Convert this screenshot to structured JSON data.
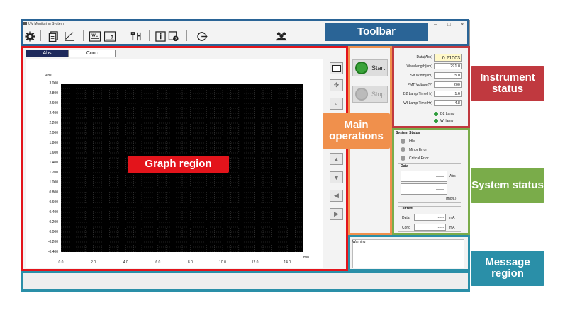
{
  "window": {
    "title": "UV Monitoring System"
  },
  "window_controls": [
    "–",
    "□",
    "×"
  ],
  "tabs": [
    {
      "label": "Abs"
    },
    {
      "label": "Conc"
    }
  ],
  "chart_data": {
    "type": "line",
    "ylabel": "Abs",
    "xlabel": "min",
    "yticks": [
      "3.000",
      "2.800",
      "2.600",
      "2.400",
      "2.200",
      "2.000",
      "1.800",
      "1.600",
      "1.400",
      "1.200",
      "1.000",
      "0.800",
      "0.600",
      "0.400",
      "0.200",
      "0.000",
      "-0.200",
      "-0.400"
    ],
    "xticks": [
      "0.0",
      "2.0",
      "4.0",
      "6.0",
      "8.0",
      "10.0",
      "12.0",
      "14.0"
    ],
    "ylim": [
      -0.4,
      3.0
    ],
    "xlim": [
      0,
      15
    ],
    "grid": true,
    "series": []
  },
  "operations": {
    "start": "Start",
    "stop": "Stop"
  },
  "instrument": {
    "rows": [
      {
        "label": "Data(Abs)",
        "value": "0.21003"
      },
      {
        "label": "Wavelength(nm)",
        "value": "291.0"
      },
      {
        "label": "Slit Width(nm)",
        "value": "5.0"
      },
      {
        "label": "PMT Voltage(V)",
        "value": "200"
      },
      {
        "label": "D2 Lamp Time(Hr)",
        "value": "1.6"
      },
      {
        "label": "WI Lamp Time(Hr)",
        "value": "4.8"
      }
    ],
    "lamps": [
      {
        "label": "D2 Lamp"
      },
      {
        "label": "WI lamp"
      }
    ]
  },
  "system": {
    "title": "System Status",
    "states": [
      {
        "label": "Idle"
      },
      {
        "label": "Minor Error"
      },
      {
        "label": "Critical Error"
      }
    ],
    "data_title": "Data",
    "data_rows": [
      {
        "value": "------",
        "unit": "Abs"
      },
      {
        "value": "------",
        "unit": "(mg/L)"
      }
    ],
    "current_title": "Current",
    "current_rows": [
      {
        "label": "Data",
        "value": "-----",
        "unit": "mA"
      },
      {
        "label": "Conc",
        "value": "-----",
        "unit": "mA"
      }
    ]
  },
  "message": {
    "label": "Warning"
  },
  "callouts": {
    "toolbar": "Toolbar",
    "graph": "Graph region",
    "main_ops": "Main operations",
    "instrument": "Instrument status",
    "system": "System status",
    "message": "Message region"
  },
  "colors": {
    "toolbar": "#2a6496",
    "graph": "#e3141b",
    "main_ops": "#f0904c",
    "instrument": "#c0393f",
    "system": "#7aac4a",
    "message": "#2a8fa8"
  },
  "icons": [
    "gear-icon",
    "document-icon",
    "graph-axis-icon",
    "wavelength-icon",
    "zero-icon",
    "tools-icon",
    "info-icon",
    "help-icon",
    "exit-icon",
    "users-icon"
  ]
}
